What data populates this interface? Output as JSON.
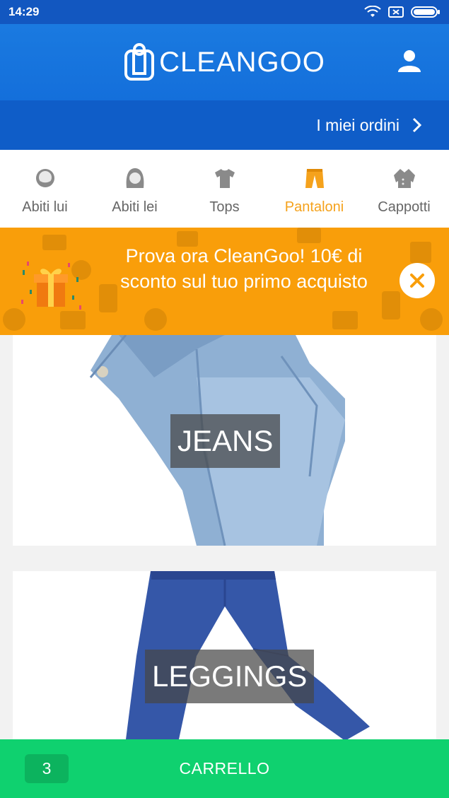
{
  "status_bar": {
    "time": "14:29"
  },
  "header": {
    "logo_text": "CLEANGOO",
    "profile_icon": "user-icon"
  },
  "orders_bar": {
    "label": "I miei ordini",
    "icon": "chevron-right-icon"
  },
  "tabs": [
    {
      "label": "Abiti lui",
      "icon": "man-face-icon",
      "active": false
    },
    {
      "label": "Abiti lei",
      "icon": "woman-face-icon",
      "active": false
    },
    {
      "label": "Tops",
      "icon": "tshirt-icon",
      "active": false
    },
    {
      "label": "Pantaloni",
      "icon": "trousers-icon",
      "active": true
    },
    {
      "label": "Cappotti",
      "icon": "coat-icon",
      "active": false
    }
  ],
  "promo": {
    "text": "Prova ora CleanGoo! 10€ di sconto sul tuo primo acquisto",
    "icon": "gift-icon",
    "close_icon": "close-icon"
  },
  "products": [
    {
      "label": "JEANS"
    },
    {
      "label": "LEGGINGS"
    }
  ],
  "cart": {
    "count": "3",
    "label": "CARRELLO"
  },
  "colors": {
    "primary_blue": "#146fdb",
    "accent_orange": "#f99e0a",
    "active_tab": "#f5a21c",
    "cart_green": "#0fd16f"
  }
}
